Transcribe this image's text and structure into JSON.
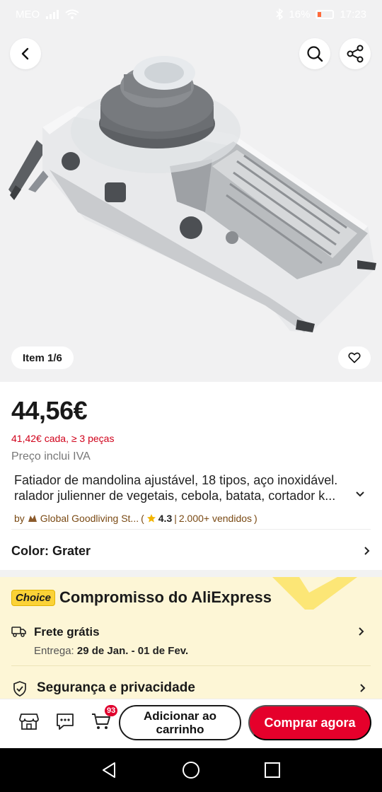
{
  "status_bar": {
    "carrier": "MEO",
    "battery": "16%",
    "time": "17:23"
  },
  "gallery": {
    "counter": "Item 1/6"
  },
  "product": {
    "price": "44,56€",
    "bulk_price": "41,42€ cada, ≥ 3 peças",
    "tax_note": "Preço inclui IVA",
    "title_line1": "Fatiador de mandolina ajustável, 18 tipos, aço inoxidável.",
    "title_line2": "ralador julienner de vegetais, cebola, batata, cortador k...",
    "seller_prefix": "by",
    "seller_name": "Global Goodliving St...",
    "rating": "4.3",
    "sold": "2.000+ vendidos",
    "color_label": "Color: Grater"
  },
  "choice": {
    "badge": "Choice",
    "title": "Compromisso do AliExpress",
    "shipping_label": "Frete grátis",
    "delivery_prefix": "Entrega:",
    "delivery_dates": "29 de Jan. - 01 de Fev.",
    "security_label": "Segurança e privacidade"
  },
  "bottom_bar": {
    "cart_count": "93",
    "add_to_cart": "Adicionar ao carrinho",
    "buy_now": "Comprar agora"
  },
  "colors": {
    "accent": "#e5002b",
    "choice_bg": "#fdf6d6",
    "choice_badge": "#fbd237",
    "bulk_price": "#d0021b"
  },
  "icons": [
    "back-icon",
    "search-icon",
    "share-icon",
    "heart-icon",
    "store-icon",
    "chat-icon",
    "cart-icon",
    "truck-icon",
    "shield-check-icon",
    "chevron-right-icon",
    "chevron-down-icon",
    "star-icon"
  ]
}
